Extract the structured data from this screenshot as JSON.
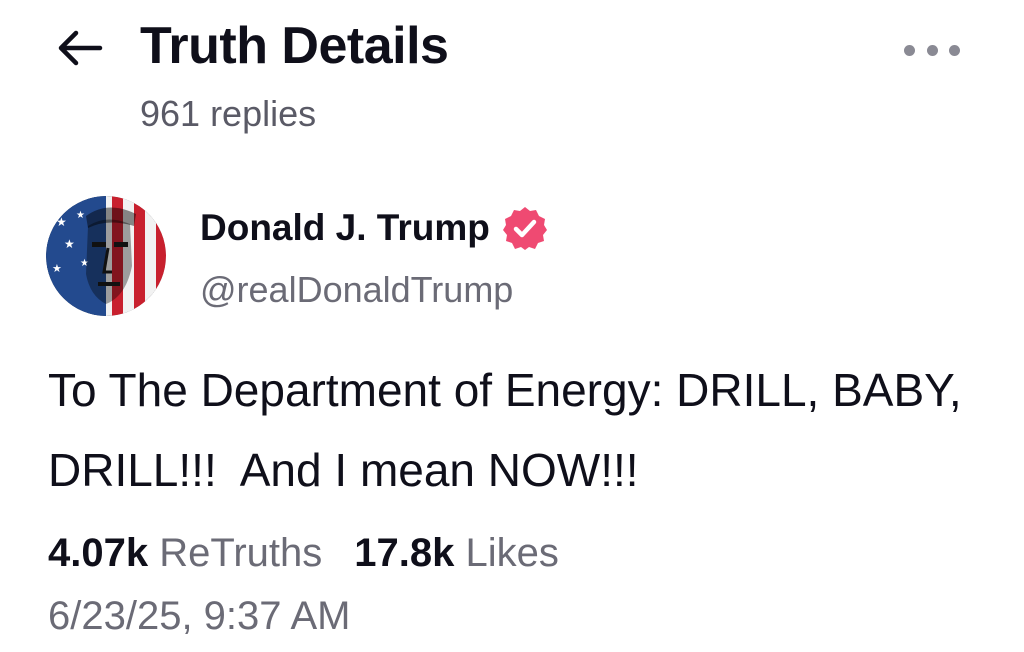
{
  "header": {
    "title": "Truth Details",
    "replies": "961 replies",
    "back_icon": "arrow-left-icon",
    "more_icon": "more-horizontal-icon"
  },
  "post": {
    "author": {
      "name": "Donald J. Trump",
      "handle": "@realDonaldTrump",
      "verified_icon": "verified-badge-icon",
      "verified_color": "#ef4a72"
    },
    "text": "To The Department of Energy: DRILL, BABY, DRILL!!!  And I mean NOW!!!",
    "stats": {
      "retruths_count": "4.07k",
      "retruths_label": "ReTruths",
      "likes_count": "17.8k",
      "likes_label": "Likes"
    },
    "timestamp": "6/23/25, 9:37 AM"
  }
}
